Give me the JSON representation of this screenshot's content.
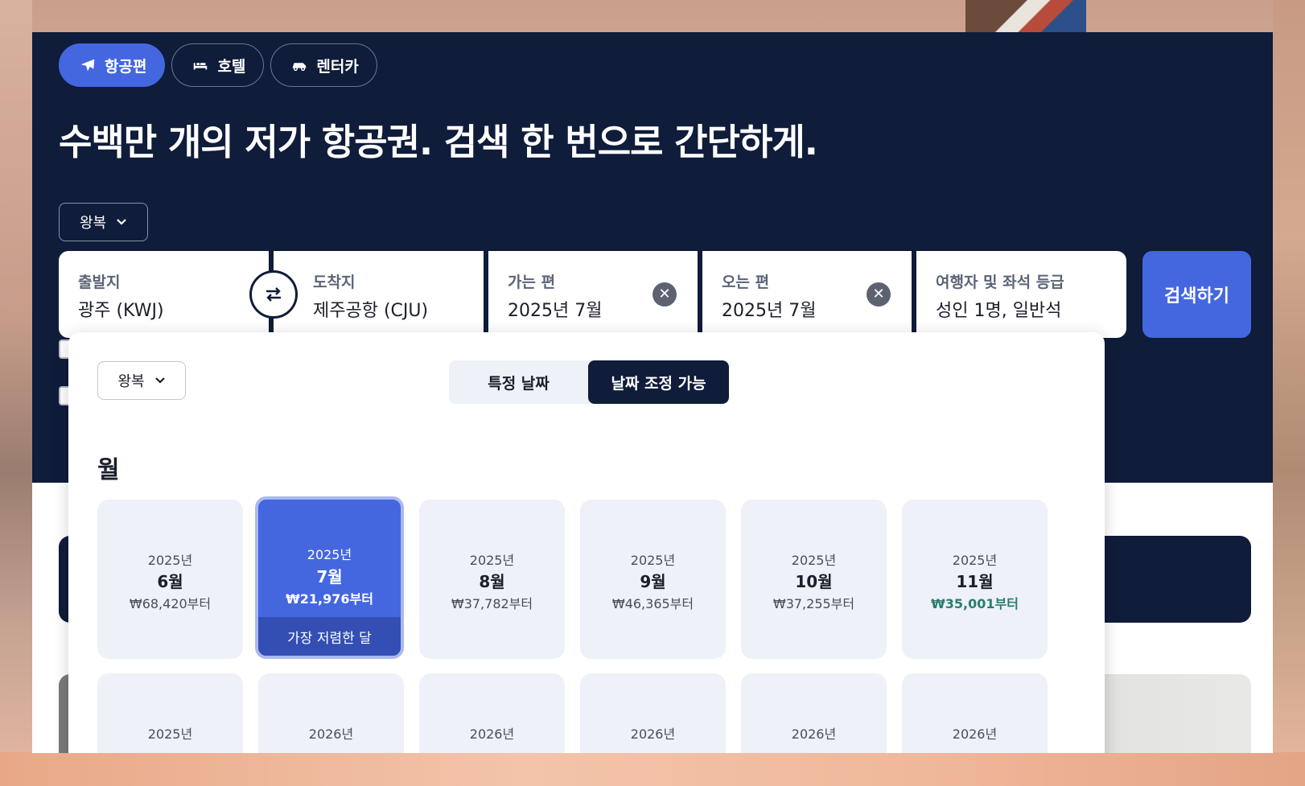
{
  "tabs": [
    {
      "label": "항공편",
      "icon": "plane-icon",
      "active": true
    },
    {
      "label": "호텔",
      "icon": "bed-icon",
      "active": false
    },
    {
      "label": "렌터카",
      "icon": "car-icon",
      "active": false
    }
  ],
  "headline": "수백만 개의 저가 항공권. 검색 한 번으로 간단하게.",
  "trip_type": "왕복",
  "search": {
    "origin": {
      "label": "출발지",
      "value": "광주 (KWJ)"
    },
    "destination": {
      "label": "도착지",
      "value": "제주공항 (CJU)"
    },
    "depart": {
      "label": "가는 편",
      "value": "2025년 7월"
    },
    "return": {
      "label": "오는 편",
      "value": "2025년 7월"
    },
    "travellers": {
      "label": "여행자 및 좌석 등급",
      "value": "성인 1명, 일반석"
    },
    "button": "검색하기"
  },
  "picker": {
    "trip_type": "왕복",
    "toggle": {
      "specific": "특정 날짜",
      "flexible": "날짜 조정 가능",
      "selected": "flexible"
    },
    "section_title": "월",
    "months": [
      {
        "year": "2025년",
        "month": "6월",
        "price": "₩68,420부터"
      },
      {
        "year": "2025년",
        "month": "7월",
        "price": "₩21,976부터",
        "selected": true,
        "badge": "가장 저렴한 달"
      },
      {
        "year": "2025년",
        "month": "8월",
        "price": "₩37,782부터"
      },
      {
        "year": "2025년",
        "month": "9월",
        "price": "₩46,365부터"
      },
      {
        "year": "2025년",
        "month": "10월",
        "price": "₩37,255부터"
      },
      {
        "year": "2025년",
        "month": "11월",
        "price": "₩35,001부터",
        "cheap": true
      }
    ],
    "next_row": [
      "2025년",
      "2026년",
      "2026년",
      "2026년",
      "2026년",
      "2026년"
    ]
  },
  "colors": {
    "hero_bg": "#0f1c3a",
    "accent": "#4467e0",
    "card_bg": "#eef1f7",
    "cheap_price": "#2a7c6f"
  }
}
